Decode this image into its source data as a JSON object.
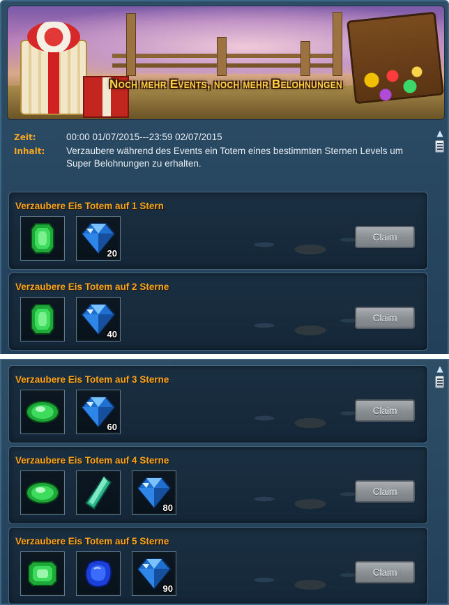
{
  "banner": {
    "title": "Noch mehr Events, noch mehr Belohnungen"
  },
  "info": {
    "time_label": "Zeit:",
    "time_value": "00:00 01/07/2015---23:59 02/07/2015",
    "content_label": "Inhalt:",
    "content_value": "Verzaubere während des Events ein Totem eines bestimmten Sternen Levels um Super Belohnungen zu erhalten."
  },
  "tasks": [
    {
      "title": "Verzaubere Eis Totem auf 1 Stern",
      "claim_label": "Claim",
      "items": [
        {
          "icon": "green-gem-icon",
          "qty": ""
        },
        {
          "icon": "blue-crystal-icon",
          "qty": "20"
        }
      ]
    },
    {
      "title": "Verzaubere Eis Totem auf 2 Sterne",
      "claim_label": "Claim",
      "items": [
        {
          "icon": "green-gem-icon",
          "qty": ""
        },
        {
          "icon": "blue-crystal-icon",
          "qty": "40"
        }
      ]
    },
    {
      "title": "Verzaubere Eis Totem auf 3 Sterne",
      "claim_label": "Claim",
      "items": [
        {
          "icon": "green-oval-gem-icon",
          "qty": ""
        },
        {
          "icon": "blue-crystal-icon",
          "qty": "60"
        }
      ]
    },
    {
      "title": "Verzaubere Eis Totem auf 4 Sterne",
      "claim_label": "Claim",
      "items": [
        {
          "icon": "green-oval-gem-icon",
          "qty": ""
        },
        {
          "icon": "green-shard-icon",
          "qty": ""
        },
        {
          "icon": "blue-crystal-icon",
          "qty": "80"
        }
      ]
    },
    {
      "title": "Verzaubere Eis Totem auf 5 Sterne",
      "claim_label": "Claim",
      "items": [
        {
          "icon": "green-emerald-icon",
          "qty": ""
        },
        {
          "icon": "blue-stone-icon",
          "qty": ""
        },
        {
          "icon": "blue-crystal-icon",
          "qty": "90"
        }
      ]
    }
  ],
  "colors": {
    "accent_orange": "#f5a623",
    "panel_bg": "#22405a",
    "button_gray": "#8b9094"
  }
}
